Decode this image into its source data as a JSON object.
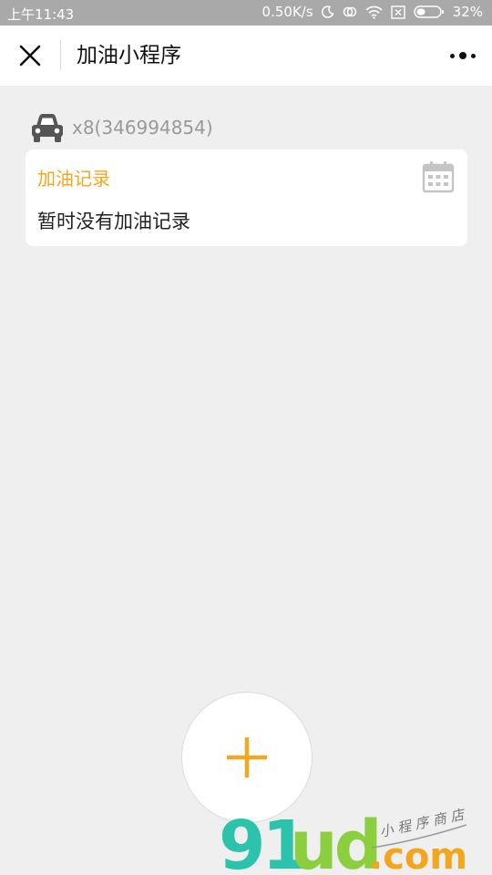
{
  "status_bar": {
    "time": "上午11:43",
    "net_speed": "0.50K/s",
    "battery": "32%",
    "icons": [
      "moon-icon",
      "sync-icon",
      "wifi-icon",
      "sim-icon",
      "battery-icon"
    ]
  },
  "nav": {
    "title": "加油小程序",
    "close_icon": "close-icon",
    "more_icon": "more-dots-icon"
  },
  "vehicle": {
    "icon": "car-icon",
    "label": "x8(346994854)"
  },
  "record_card": {
    "title": "加油记录",
    "empty_text": "暂时没有加油记录",
    "icon": "calendar-icon"
  },
  "fab": {
    "icon": "plus-icon"
  },
  "watermark": {
    "brand": "91ud",
    "domain": ".com",
    "tagline": "小程序商店"
  },
  "colors": {
    "accent": "#f3a71f",
    "status_bar_bg": "#a9a9a9",
    "page_bg": "#efefef",
    "icon_gray": "#555555",
    "watermark_teal": "#2cc3ad",
    "watermark_green": "#8ccf3e",
    "watermark_orange": "#f4a51e"
  }
}
